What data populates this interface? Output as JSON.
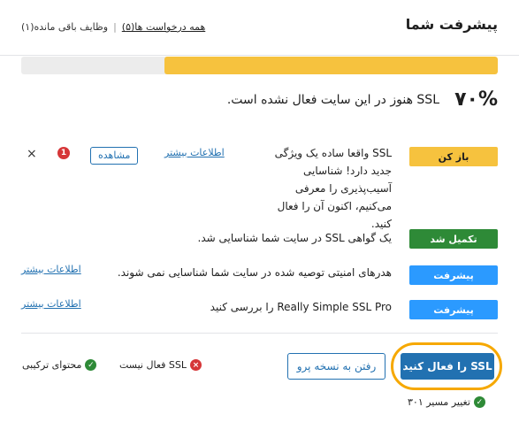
{
  "header": {
    "title": "پیشرفت شما",
    "all_requests_link": "همه درخواست ها(۵)",
    "remaining_tasks": "وظایف باقی مانده(۱)"
  },
  "progress": {
    "percent_value": 0.7,
    "percent_label": "۷۰%",
    "status_text": "SSL هنوز در این سایت فعال نشده است."
  },
  "tasks": [
    {
      "badge": "باز کن",
      "badge_kind": "open",
      "text": "SSL واقعا ساده یک ویژگی جدید دارد! شناسایی آسیب‌پذیری را معرفی می‌کنیم، اکنون آن را فعال کنید.",
      "link": "اطلاعات بیشتر",
      "view_button": "مشاهده",
      "alert_count": "1",
      "dismiss": "×"
    },
    {
      "badge": "تکمیل شد",
      "badge_kind": "done",
      "text": "یک گواهی SSL در سایت شما شناسایی شد."
    },
    {
      "badge": "پیشرفت",
      "badge_kind": "premium",
      "text": "هدرهای امنیتی توصیه شده در سایت شما شناسایی نمی شوند.",
      "link": "اطلاعات بیشتر"
    },
    {
      "badge": "پیشرفت",
      "badge_kind": "premium",
      "text": "Really Simple SSL Pro را بررسی کنید",
      "link": "اطلاعات بیشتر"
    }
  ],
  "footer": {
    "activate_button": "SSL را فعال کنید",
    "pro_button": "رفتن به نسخه پرو",
    "statuses": [
      {
        "label": "SSL فعال نیست",
        "state": "bad"
      },
      {
        "label": "محتوای ترکیبی",
        "state": "ok"
      },
      {
        "label": "تغییر مسیر ۳۰۱",
        "state": "ok"
      }
    ]
  },
  "colors": {
    "accent": "#2271b1",
    "progress_fill": "#f6c23e",
    "highlight": "#f6a800",
    "done": "#2e8a37",
    "premium": "#2b9aff",
    "error": "#d63638"
  }
}
